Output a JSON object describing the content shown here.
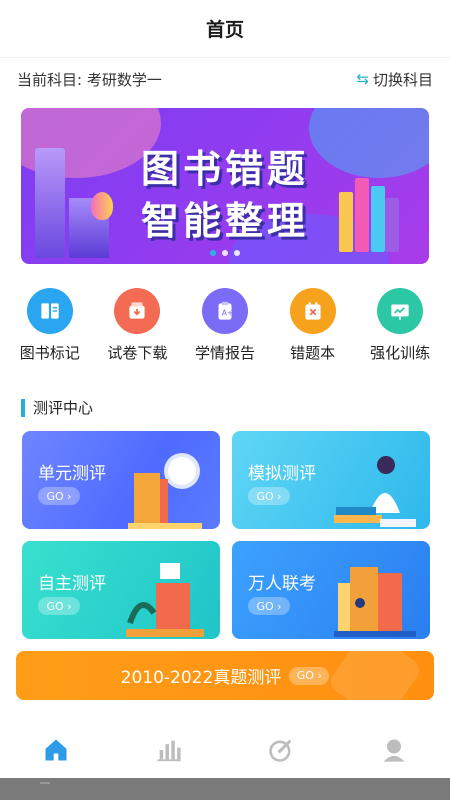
{
  "header": {
    "title": "首页"
  },
  "subject": {
    "current_label": "当前科目: 考研数学一",
    "switch_label": "切换科目"
  },
  "banner": {
    "line1": "图书错题",
    "line2": "智能整理",
    "slide_count": 3,
    "active_slide": 1
  },
  "features": [
    {
      "label": "图书标记",
      "icon": "book-mark-icon",
      "color": "#2aa6f0"
    },
    {
      "label": "试卷下载",
      "icon": "download-icon",
      "color": "#f26b52"
    },
    {
      "label": "学情报告",
      "icon": "report-icon",
      "color": "#7a6cf5"
    },
    {
      "label": "错题本",
      "icon": "wrong-book-icon",
      "color": "#f7a21d"
    },
    {
      "label": "强化训练",
      "icon": "training-icon",
      "color": "#2cc7a4"
    }
  ],
  "section": {
    "title": "测评中心"
  },
  "cards": [
    {
      "name": "单元测评",
      "go": "GO ›"
    },
    {
      "name": "模拟测评",
      "go": "GO ›"
    },
    {
      "name": "自主测评",
      "go": "GO ›"
    },
    {
      "name": "万人联考",
      "go": "GO ›"
    }
  ],
  "real_exam": {
    "label": "2010-2022真题测评",
    "go": "GO ›"
  },
  "tabbar": [
    {
      "icon": "home-icon",
      "active": true
    },
    {
      "icon": "stats-icon",
      "active": false
    },
    {
      "icon": "edit-icon",
      "active": false
    },
    {
      "icon": "profile-icon",
      "active": false
    }
  ],
  "colors": {
    "accent": "#2bb3e8",
    "tab_active": "#2d9be6",
    "tab_inactive": "#bdbdbd"
  }
}
